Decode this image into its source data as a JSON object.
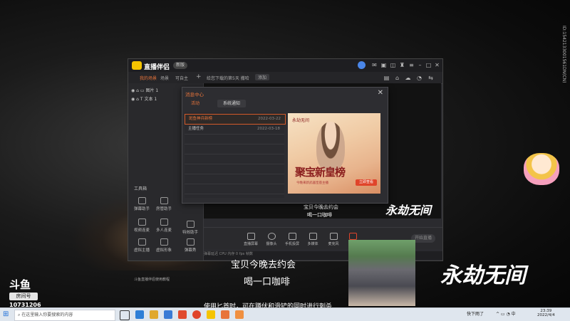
{
  "app": {
    "title": "直播伴侣",
    "version": "新版",
    "tabs": [
      "我的场景",
      "场景",
      "可自主",
      "+"
    ],
    "scene_tab_note": "给您下载的第5天 撒哈",
    "scene_tab_btn": "添加",
    "scenes": [
      {
        "label": "图片 1"
      },
      {
        "label": "文本 1"
      }
    ],
    "tools_title": "工具箱",
    "tools": [
      {
        "label": "弹幕助手"
      },
      {
        "label": "房管助手"
      },
      {
        "label": "视频连麦"
      },
      {
        "label": "多人连麦"
      },
      {
        "label": "特效助手"
      },
      {
        "label": "虚拟主播"
      },
      {
        "label": "虚拟形象"
      },
      {
        "label": "弹幕秀"
      },
      {
        "label": "斗鱼直播伴侣使用教程"
      }
    ],
    "controls": [
      {
        "label": "直播屏幕",
        "icon": "screen-icon"
      },
      {
        "label": "摄像头",
        "icon": "camera-icon"
      },
      {
        "label": "手机投屏",
        "icon": "phone-icon"
      },
      {
        "label": "多媒体",
        "icon": "media-icon"
      },
      {
        "label": "麦克风",
        "icon": "mic-icon"
      },
      {
        "label": "声音",
        "icon": "speaker-icon"
      }
    ],
    "start_btn": "开始直播",
    "status": "弹幕延迟 CPU  内存  0  fps  帧数"
  },
  "dialog": {
    "title": "消息中心",
    "tabs": [
      "活动",
      "系统通知"
    ],
    "messages": [
      {
        "title": "斑鱼神兵新榜",
        "date": "2022-03-22"
      },
      {
        "title": "主播任务",
        "date": "2022-03-18"
      }
    ],
    "banner": {
      "logo": "永劫无间",
      "headline": "聚宝新皇榜",
      "sub": "今晚来新武器皇座主播",
      "button": "立即查看"
    }
  },
  "overlay": {
    "subtitle_line1": "宝贝今晚去约会",
    "subtitle_line2": "喝一口咖啡",
    "subtitle_line3": "使用匕首时，可在蹲伏和滑铲的同时进行刺杀",
    "game_logo": "永劫无间",
    "douyu_logo": "斗鱼",
    "room_label": "房间号",
    "room_number": "10731206",
    "vertical_id": "ID:1542133001561DN(CN)"
  },
  "taskbar": {
    "search_placeholder": "在这里输入你要搜索的内容",
    "weather": "快下雨了",
    "time": "23:39",
    "date": "2022/4/4"
  }
}
